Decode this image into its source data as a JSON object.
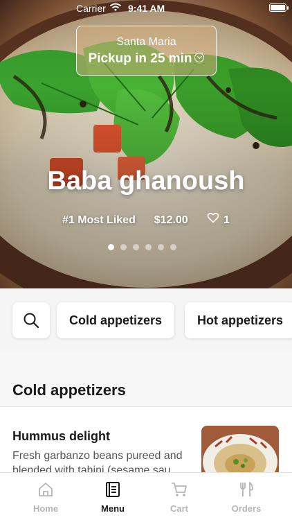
{
  "status_bar": {
    "carrier": "Carrier",
    "time": "9:41 AM"
  },
  "pickup": {
    "location": "Santa Maria",
    "eta": "Pickup in 25 min"
  },
  "featured": {
    "title": "Baba ghanoush",
    "badge": "#1 Most Liked",
    "price": "$12.00",
    "likes": "1",
    "carousel": {
      "total": 6,
      "active_index": 0
    }
  },
  "categories": [
    {
      "label": "Cold appetizers"
    },
    {
      "label": "Hot appetizers"
    }
  ],
  "section": {
    "title": "Cold appetizers"
  },
  "items": [
    {
      "name": "Hummus delight",
      "description": "Fresh garbanzo beans pureed and blended with tahini (sesame sau..."
    }
  ],
  "tabs": [
    {
      "label": "Home",
      "icon": "home-icon",
      "active": false
    },
    {
      "label": "Menu",
      "icon": "menu-book-icon",
      "active": true
    },
    {
      "label": "Cart",
      "icon": "cart-icon",
      "active": false
    },
    {
      "label": "Orders",
      "icon": "fork-knife-icon",
      "active": false
    }
  ],
  "colors": {
    "active_tab": "#1a1a1a",
    "inactive_tab": "#b5b5b5",
    "accent_white": "#ffffff"
  }
}
